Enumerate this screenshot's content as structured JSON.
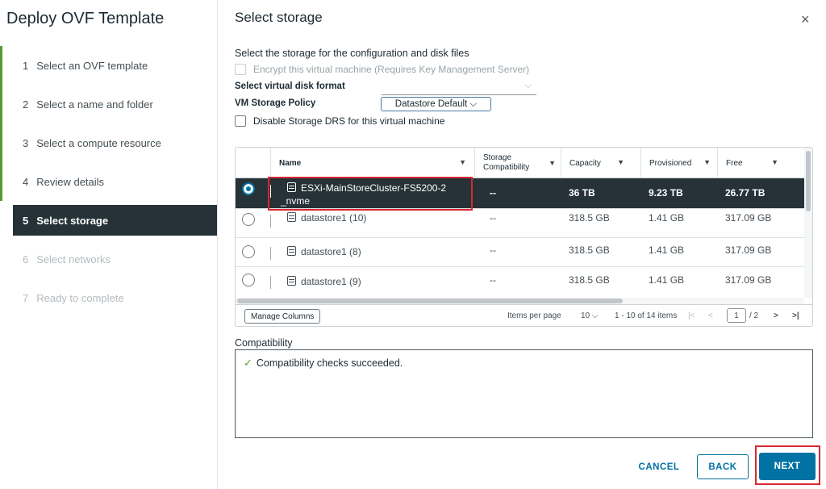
{
  "wizard": {
    "title": "Deploy OVF Template",
    "steps": [
      {
        "num": "1",
        "label": "Select an OVF template",
        "state": "done"
      },
      {
        "num": "2",
        "label": "Select a name and folder",
        "state": "done"
      },
      {
        "num": "3",
        "label": "Select a compute resource",
        "state": "done"
      },
      {
        "num": "4",
        "label": "Review details",
        "state": "done"
      },
      {
        "num": "5",
        "label": "Select storage",
        "state": "active"
      },
      {
        "num": "6",
        "label": "Select networks",
        "state": "pending"
      },
      {
        "num": "7",
        "label": "Ready to complete",
        "state": "pending"
      }
    ]
  },
  "page": {
    "title": "Select storage",
    "close_icon": "×",
    "description": "Select the storage for the configuration and disk files",
    "encrypt_label": "Encrypt this virtual machine (Requires Key Management Server)",
    "disk_format_label": "Select virtual disk format",
    "disk_format_chevron": "⌵",
    "policy_label": "VM Storage Policy",
    "policy_value": "Datastore Default ⌵",
    "disable_drs_label": "Disable Storage DRS for this virtual machine"
  },
  "grid": {
    "columns": {
      "name": "Name",
      "storage_compat_line1": "Storage",
      "storage_compat_line2": "Compatibility",
      "capacity": "Capacity",
      "provisioned": "Provisioned",
      "free": "Free",
      "filter_icon": "▼"
    },
    "rows": [
      {
        "name_line1": "ESXi-MainStoreCluster-FS5200-2",
        "name_line2": "_nvme",
        "compat": "--",
        "capacity": "36 TB",
        "provisioned": "9.23 TB",
        "free": "26.77 TB",
        "selected": true,
        "icon": "datastore-cluster-icon"
      },
      {
        "name_line1": "datastore1 (10)",
        "compat": "--",
        "capacity": "318.5 GB",
        "provisioned": "1.41 GB",
        "free": "317.09 GB",
        "selected": false,
        "icon": "datastore-icon"
      },
      {
        "name_line1": "datastore1 (8)",
        "compat": "--",
        "capacity": "318.5 GB",
        "provisioned": "1.41 GB",
        "free": "317.09 GB",
        "selected": false,
        "icon": "datastore-icon"
      },
      {
        "name_line1": "datastore1 (9)",
        "compat": "--",
        "capacity": "318.5 GB",
        "provisioned": "1.41 GB",
        "free": "317.09 GB",
        "selected": false,
        "icon": "datastore-icon"
      }
    ],
    "footer": {
      "manage_columns": "Manage Columns",
      "items_per_page_label": "Items per page",
      "items_per_page_value": "10 ⌵",
      "range": "1 - 10 of 14 items",
      "first_icon": "|<",
      "prev_icon": "<",
      "page_current": "1",
      "page_total": "/ 2",
      "next_icon": ">",
      "last_icon": ">|"
    }
  },
  "compatibility": {
    "label": "Compatibility",
    "check_icon": "✓",
    "message": "Compatibility checks succeeded."
  },
  "buttons": {
    "cancel": "CANCEL",
    "back": "BACK",
    "next": "NEXT"
  },
  "colors": {
    "selected_bg": "#263238",
    "accent": "#0072a3",
    "done_bar": "#5c9a2f",
    "highlight": "#d9282f"
  }
}
